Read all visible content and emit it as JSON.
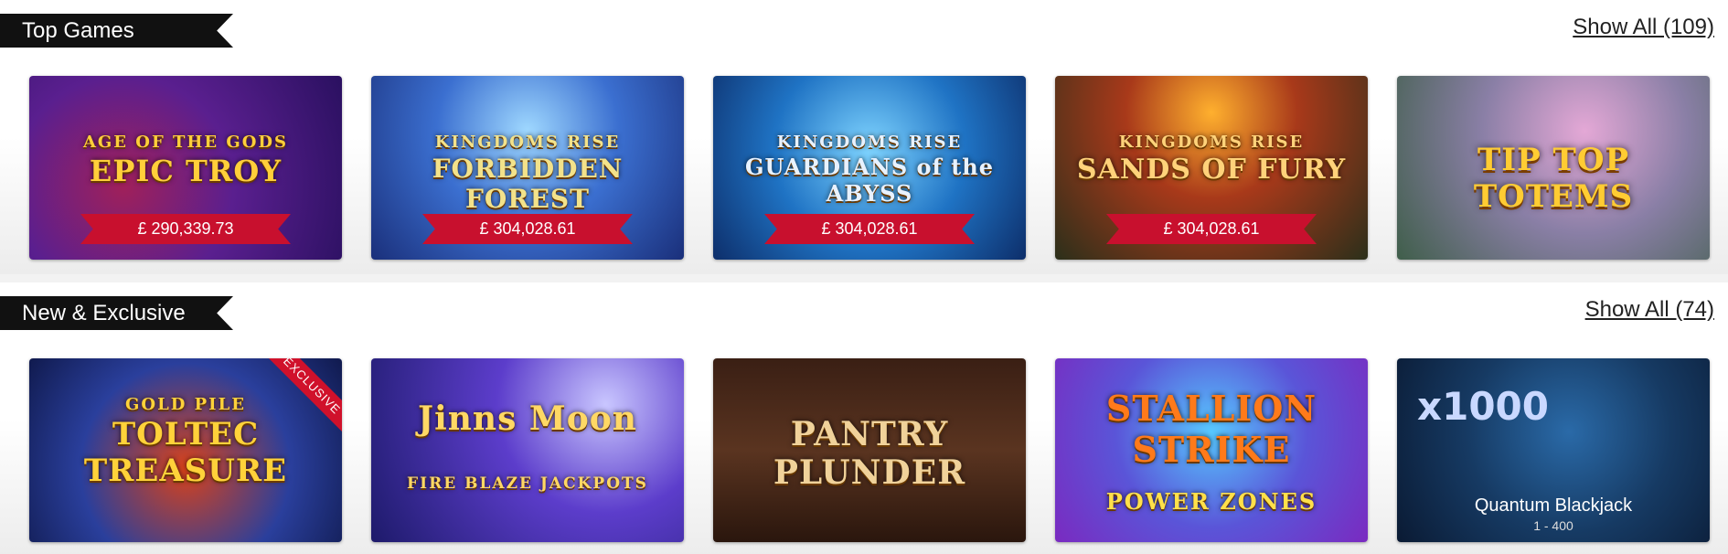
{
  "sections": [
    {
      "title": "Top Games",
      "show_all": "Show All (109)",
      "tiles": [
        {
          "subtitle": "AGE OF THE GODS",
          "title": "EPIC TROY",
          "jackpot": "£ 290,339.73"
        },
        {
          "subtitle": "KINGDOMS RISE",
          "title": "FORBIDDEN FOREST",
          "jackpot": "£ 304,028.61"
        },
        {
          "subtitle": "KINGDOMS RISE",
          "title": "GUARDIANS of the ABYSS",
          "jackpot": "£ 304,028.61"
        },
        {
          "subtitle": "KINGDOMS RISE",
          "title": "SANDS OF FURY",
          "jackpot": "£ 304,028.61"
        },
        {
          "subtitle": "",
          "title": "TIP TOP TOTEMS",
          "jackpot": ""
        }
      ]
    },
    {
      "title": "New & Exclusive",
      "show_all": "Show All (74)",
      "tiles": [
        {
          "subtitle": "GOLD PILE",
          "title": "TOLTEC TREASURE",
          "badge": "EXCLUSIVE"
        },
        {
          "subtitle": "FIRE BLAZE JACKPOTS",
          "title": "Jinns Moon"
        },
        {
          "subtitle": "",
          "title": "PANTRY PLUNDER"
        },
        {
          "subtitle": "POWER ZONES",
          "title": "STALLION STRIKE"
        },
        {
          "multiplier": "x1000",
          "name": "Quantum Blackjack",
          "limits": "1 - 400"
        }
      ]
    }
  ],
  "colors": {
    "jackpot_banner": "#c8102e",
    "section_header_bg": "#111111",
    "exclusive_ribbon": "#d0112b"
  }
}
